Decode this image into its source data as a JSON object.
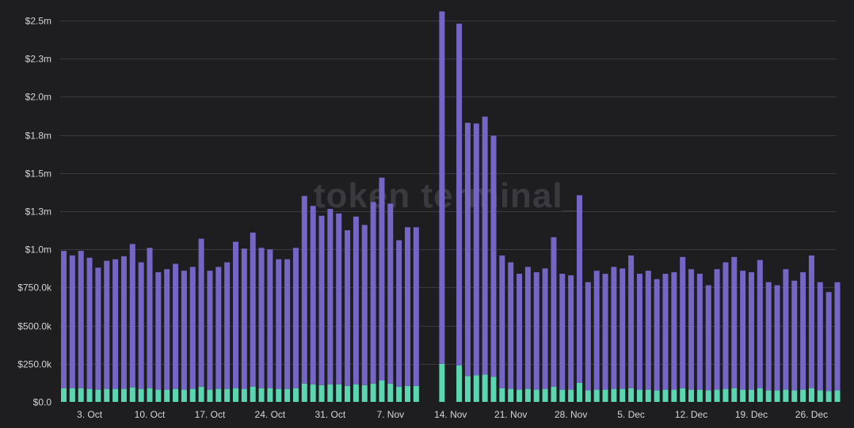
{
  "watermark": "token terminal_",
  "colors": {
    "background": "#1e1e20",
    "grid": "#3a3a3e",
    "tick_text": "#d4d4d8",
    "series_top": "#7565c4",
    "series_bottom": "#5cd6b0"
  },
  "chart_data": {
    "type": "bar",
    "stacked": true,
    "grid": true,
    "legend": "none",
    "ylim": [
      0,
      2560000
    ],
    "y_ticks": [
      {
        "value": 0,
        "label": "$0.0"
      },
      {
        "value": 250000,
        "label": "$250.0k"
      },
      {
        "value": 500000,
        "label": "$500.0k"
      },
      {
        "value": 750000,
        "label": "$750.0k"
      },
      {
        "value": 1000000,
        "label": "$1.0m"
      },
      {
        "value": 1250000,
        "label": "$1.3m"
      },
      {
        "value": 1500000,
        "label": "$1.5m"
      },
      {
        "value": 1750000,
        "label": "$1.8m"
      },
      {
        "value": 2000000,
        "label": "$2.0m"
      },
      {
        "value": 2250000,
        "label": "$2.3m"
      },
      {
        "value": 2500000,
        "label": "$2.5m"
      }
    ],
    "x_tick_labels": [
      {
        "index": 3,
        "label": "3. Oct"
      },
      {
        "index": 10,
        "label": "10. Oct"
      },
      {
        "index": 17,
        "label": "17. Oct"
      },
      {
        "index": 24,
        "label": "24. Oct"
      },
      {
        "index": 31,
        "label": "31. Oct"
      },
      {
        "index": 38,
        "label": "7. Nov"
      },
      {
        "index": 45,
        "label": "14. Nov"
      },
      {
        "index": 52,
        "label": "21. Nov"
      },
      {
        "index": 59,
        "label": "28. Nov"
      },
      {
        "index": 66,
        "label": "5. Dec"
      },
      {
        "index": 73,
        "label": "12. Dec"
      },
      {
        "index": 80,
        "label": "19. Dec"
      },
      {
        "index": 87,
        "label": "26. Dec"
      }
    ],
    "series": [
      {
        "values": [
          900000,
          870000,
          900000,
          860000,
          800000,
          840000,
          850000,
          870000,
          940000,
          830000,
          920000,
          770000,
          790000,
          820000,
          780000,
          800000,
          970000,
          780000,
          800000,
          830000,
          960000,
          920000,
          1010000,
          920000,
          910000,
          850000,
          850000,
          920000,
          1230000,
          1170000,
          1110000,
          1150000,
          1120000,
          1020000,
          1100000,
          1050000,
          1190000,
          1330000,
          1180000,
          960000,
          1040000,
          1040000,
          0,
          0,
          2310000,
          0,
          2240000,
          1660000,
          1650000,
          1690000,
          1580000,
          870000,
          830000,
          760000,
          800000,
          770000,
          790000,
          980000,
          760000,
          750000,
          1230000,
          710000,
          780000,
          760000,
          800000,
          790000,
          870000,
          760000,
          780000,
          730000,
          760000,
          770000,
          860000,
          790000,
          760000,
          690000,
          790000,
          830000,
          860000,
          780000,
          770000,
          840000,
          710000,
          690000,
          790000,
          720000,
          770000,
          870000,
          710000,
          650000,
          710000
        ]
      },
      {
        "values": [
          90000,
          90000,
          90000,
          85000,
          80000,
          85000,
          85000,
          85000,
          95000,
          85000,
          90000,
          80000,
          80000,
          85000,
          80000,
          85000,
          100000,
          80000,
          85000,
          85000,
          90000,
          85000,
          100000,
          90000,
          90000,
          85000,
          85000,
          90000,
          120000,
          115000,
          110000,
          115000,
          115000,
          105000,
          115000,
          110000,
          120000,
          140000,
          120000,
          100000,
          105000,
          105000,
          0,
          0,
          250000,
          0,
          240000,
          170000,
          175000,
          180000,
          165000,
          90000,
          85000,
          80000,
          85000,
          80000,
          85000,
          100000,
          80000,
          80000,
          125000,
          75000,
          80000,
          80000,
          85000,
          85000,
          90000,
          80000,
          80000,
          75000,
          80000,
          80000,
          90000,
          80000,
          80000,
          75000,
          80000,
          85000,
          90000,
          80000,
          80000,
          90000,
          75000,
          75000,
          80000,
          75000,
          80000,
          90000,
          75000,
          70000,
          75000
        ]
      }
    ]
  }
}
